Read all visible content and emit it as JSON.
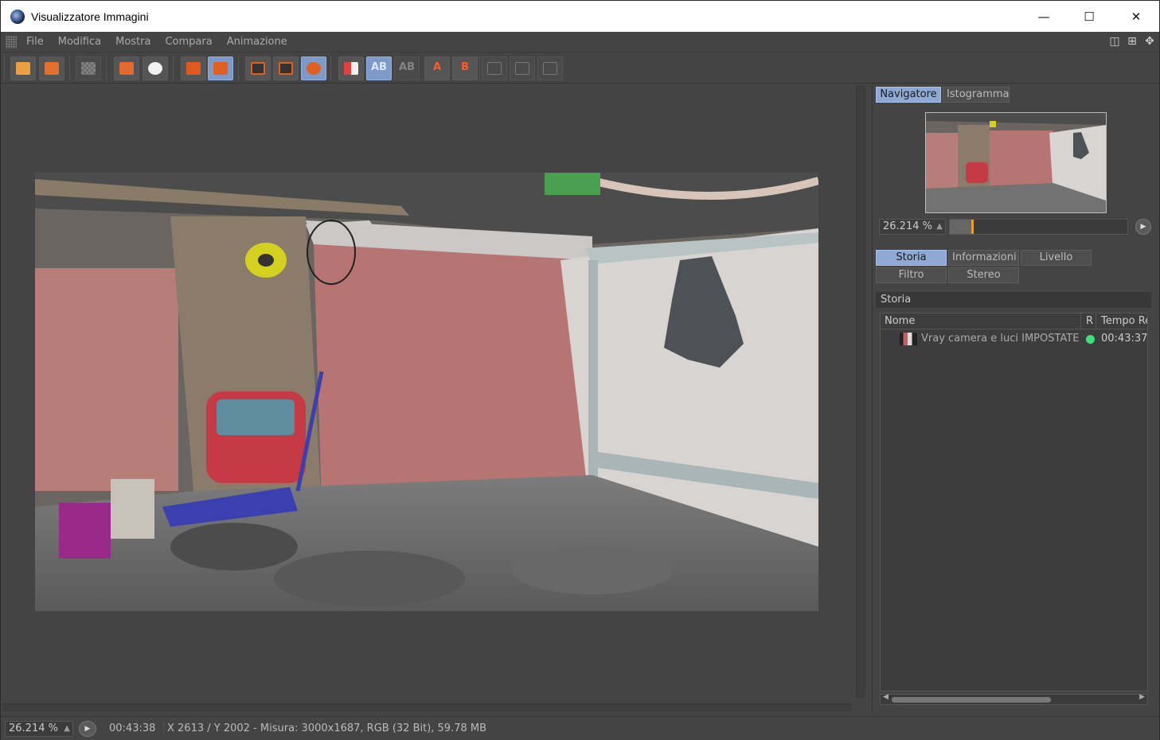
{
  "window": {
    "title": "Visualizzatore Immagini"
  },
  "menu": [
    "File",
    "Modifica",
    "Mostra",
    "Compara",
    "Animazione"
  ],
  "toolbar": {
    "compare_a_label": "A",
    "compare_b_label": "B",
    "ab_label": "AB"
  },
  "side": {
    "nav_tabs": [
      "Navigatore",
      "Istogramma"
    ],
    "zoom": "26.214 %",
    "zoom_level_fraction": 0.12,
    "history_tabs_row1": [
      "Storia",
      "Informazioni",
      "Livello"
    ],
    "history_tabs_row2": [
      "Filtro",
      "Stereo"
    ],
    "section_title": "Storia",
    "columns": {
      "name": "Nome",
      "r": "R",
      "time": "Tempo Re"
    },
    "rows": [
      {
        "name": "Vray camera e luci IMPOSTATE *",
        "status": "green",
        "time": "00:43:37"
      }
    ]
  },
  "status": {
    "zoom": "26.214 %",
    "time": "00:43:38",
    "info": "X 2613 / Y 2002 - Misura: 3000x1687, RGB (32 Bit), 59.78 MB"
  },
  "colors": {
    "accent": "#8fa9d4",
    "active_toolbar": "#7d9ac8",
    "status_ok": "#40e080"
  }
}
